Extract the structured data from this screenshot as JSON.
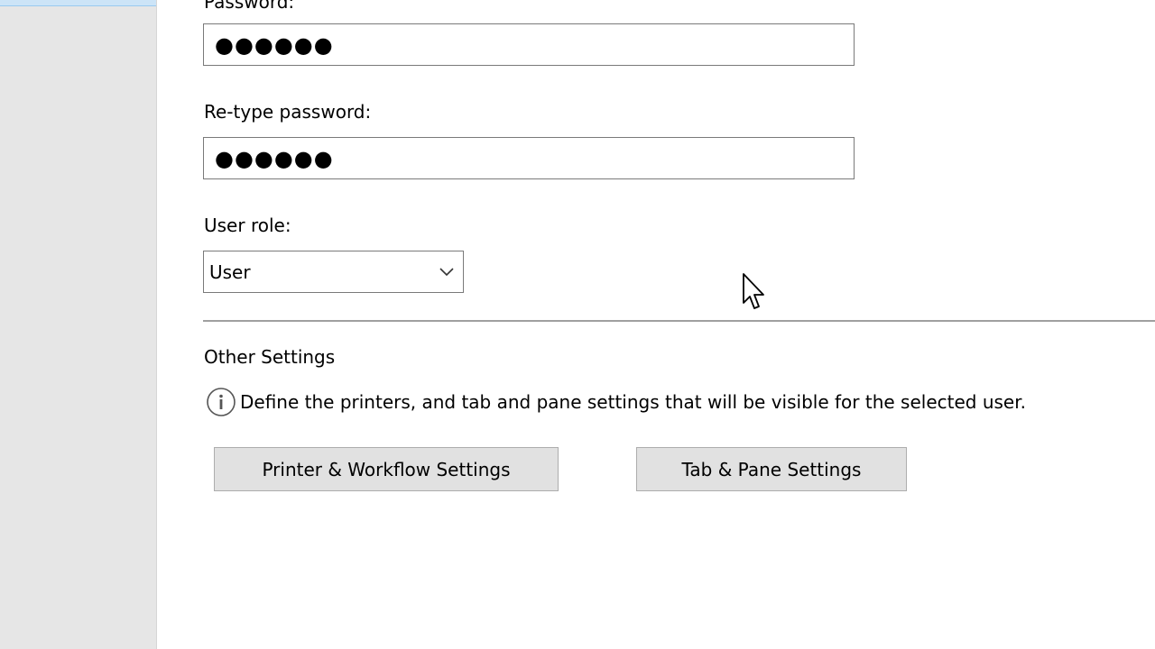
{
  "sidebar": {
    "selected_item": ""
  },
  "form": {
    "password_label": "Password:",
    "password_value": "●●●●●●",
    "retype_label": "Re-type password:",
    "retype_value": "●●●●●●",
    "role_label": "User role:",
    "role_value": "User"
  },
  "other_settings": {
    "heading": "Other Settings",
    "info_text": "Define the printers, and tab and pane settings that will be visible for the selected user.",
    "printer_button": "Printer & Workflow Settings",
    "tab_button": "Tab & Pane Settings"
  },
  "icons": {
    "info": "info-icon",
    "dropdown": "chevron-down-icon",
    "cursor": "mouse-pointer-icon"
  },
  "colors": {
    "sidebar_bg": "#e6e6e6",
    "selection": "#cce4f7",
    "button_bg": "#e1e1e1",
    "border": "#7a7a7a"
  }
}
